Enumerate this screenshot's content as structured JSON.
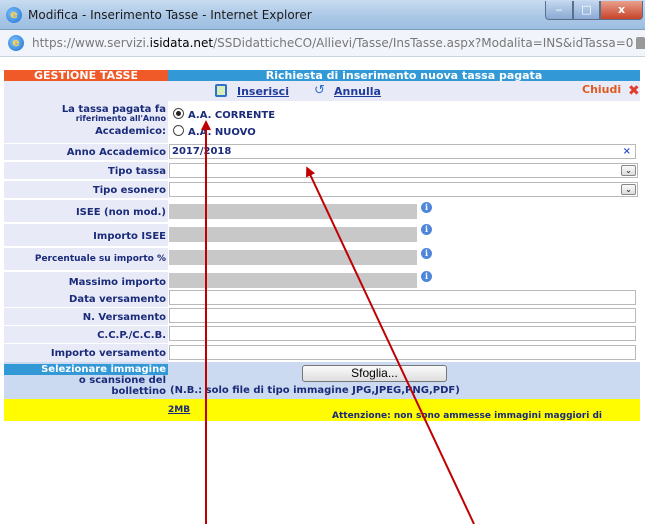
{
  "window": {
    "title": "Modifica - Inserimento Tasse - Internet Explorer",
    "close_glyph": "x"
  },
  "address": {
    "prefix": "https://www.servizi.",
    "domain": "isidata.net",
    "path": "/SSDidatticheCO/Allievi/Tasse/InsTasse.aspx?Modalita=INS&idTassa=0"
  },
  "header": {
    "left": "GESTIONE TASSE",
    "right": "Richiesta di inserimento nuova tassa pagata"
  },
  "toolbar": {
    "insert": "Inserisci",
    "cancel": "Annulla",
    "close": "Chiudi"
  },
  "form": {
    "year_ref_label_1": "La tassa pagata fa",
    "year_ref_label_2": "riferimento all'Anno",
    "year_ref_label_3": "Accademico:",
    "radio_current": "A.A. CORRENTE",
    "radio_new": "A.A. NUOVO",
    "anno_label": "Anno Accademico",
    "anno_value": "2017/2018",
    "clear_glyph": "×",
    "tipo_tassa_label": "Tipo tassa",
    "tipo_esonero_label": "Tipo esonero",
    "isee_label": "ISEE (non mod.)",
    "importo_isee_label": "Importo ISEE",
    "percentuale_label": "Percentuale su importo %",
    "massimo_label": "Massimo importo",
    "data_versamento_label": "Data versamento",
    "n_versamento_label": "N. Versamento",
    "ccp_label": "C.C.P./C.C.B.",
    "importo_versamento_label": "Importo versamento",
    "info_glyph": "i",
    "dropdown_glyph": "⌄"
  },
  "upload": {
    "label_1": "Selezionare immagine",
    "label_2": "o scansione del",
    "label_3": "bollettino",
    "browse": "Sfoglia...",
    "note": "(N.B.: solo file di tipo immagine JPG,JPEG,PNG,PDF)"
  },
  "warning": {
    "text": "Attenzione: non sono ammesse immagini maggiori di ",
    "link": "2MB",
    "suffix": "."
  },
  "colors": {
    "arrow": "#c00000",
    "header_left": "#f05a28",
    "header_right": "#3399d6",
    "warning": "#fffb00"
  }
}
